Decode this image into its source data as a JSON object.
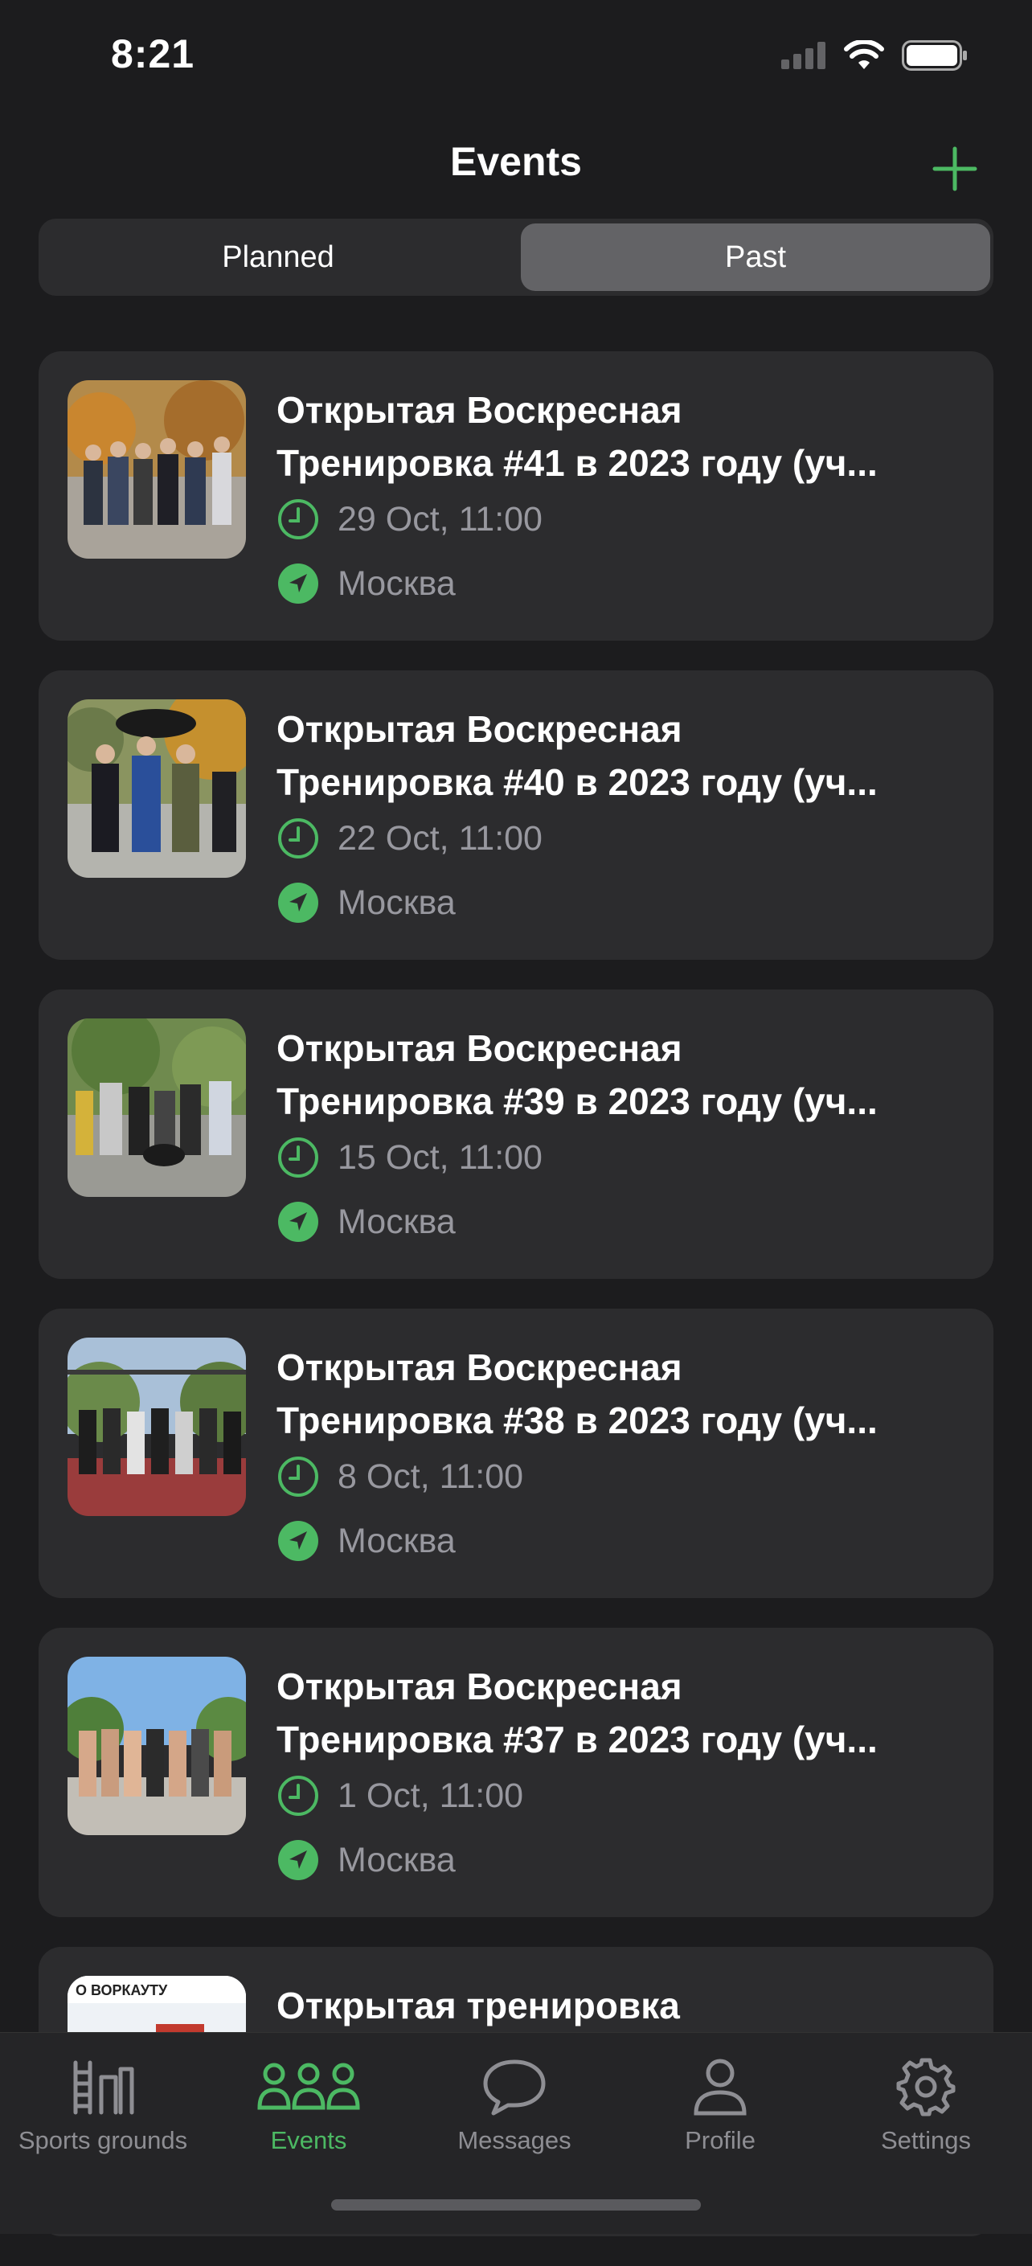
{
  "status_bar": {
    "time": "8:21"
  },
  "nav": {
    "title": "Events"
  },
  "segments": {
    "planned": "Planned",
    "past": "Past",
    "selected": "past"
  },
  "events": [
    {
      "title_line1": "Открытая Воскресная",
      "title_line2": "Тренировка #41 в 2023 году (уч...",
      "date": "29 Oct, 11:00",
      "location": "Москва"
    },
    {
      "title_line1": "Открытая Воскресная",
      "title_line2": "Тренировка #40 в 2023 году (уч...",
      "date": "22 Oct, 11:00",
      "location": "Москва"
    },
    {
      "title_line1": "Открытая Воскресная",
      "title_line2": "Тренировка #39 в 2023 году (уч...",
      "date": "15 Oct, 11:00",
      "location": "Москва"
    },
    {
      "title_line1": "Открытая Воскресная",
      "title_line2": "Тренировка #38 в 2023 году (уч...",
      "date": "8 Oct, 11:00",
      "location": "Москва"
    },
    {
      "title_line1": "Открытая Воскресная",
      "title_line2": "Тренировка #37 в 2023 году (уч...",
      "date": "1 Oct, 11:00",
      "location": "Москва"
    },
    {
      "title_line1": "Открытая тренировка",
      "title_line2": "",
      "date": "",
      "location": "",
      "thumb_text": "О ВОРКАУТУ"
    }
  ],
  "tabs": [
    {
      "label": "Sports grounds",
      "icon": "sports-grounds-icon"
    },
    {
      "label": "Events",
      "icon": "people-icon"
    },
    {
      "label": "Messages",
      "icon": "message-bubble-icon"
    },
    {
      "label": "Profile",
      "icon": "person-icon"
    },
    {
      "label": "Settings",
      "icon": "gear-icon"
    }
  ],
  "colors": {
    "accent": "#4cb963",
    "background": "#1c1c1e",
    "card": "#2c2c2e"
  }
}
